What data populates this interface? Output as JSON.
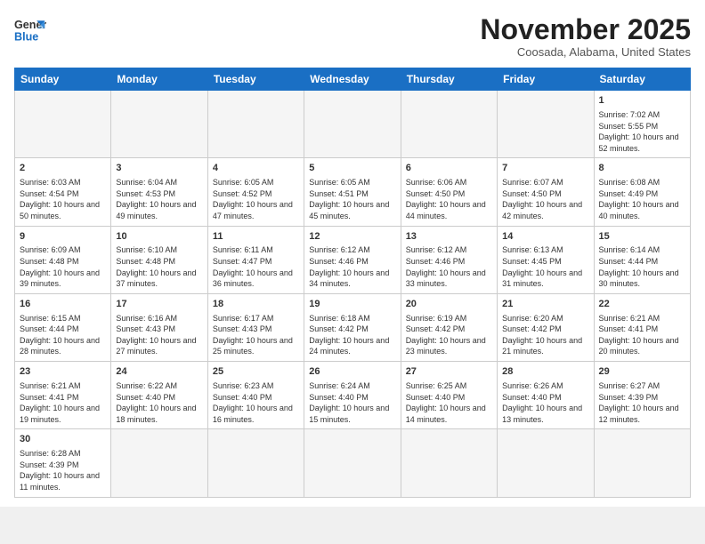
{
  "header": {
    "logo_general": "General",
    "logo_blue": "Blue",
    "month_title": "November 2025",
    "location": "Coosada, Alabama, United States"
  },
  "days_of_week": [
    "Sunday",
    "Monday",
    "Tuesday",
    "Wednesday",
    "Thursday",
    "Friday",
    "Saturday"
  ],
  "weeks": [
    [
      {
        "num": "",
        "info": "",
        "empty": true
      },
      {
        "num": "",
        "info": "",
        "empty": true
      },
      {
        "num": "",
        "info": "",
        "empty": true
      },
      {
        "num": "",
        "info": "",
        "empty": true
      },
      {
        "num": "",
        "info": "",
        "empty": true
      },
      {
        "num": "",
        "info": "",
        "empty": true
      },
      {
        "num": "1",
        "info": "Sunrise: 7:02 AM\nSunset: 5:55 PM\nDaylight: 10 hours\nand 52 minutes."
      }
    ],
    [
      {
        "num": "2",
        "info": "Sunrise: 6:03 AM\nSunset: 4:54 PM\nDaylight: 10 hours\nand 50 minutes."
      },
      {
        "num": "3",
        "info": "Sunrise: 6:04 AM\nSunset: 4:53 PM\nDaylight: 10 hours\nand 49 minutes."
      },
      {
        "num": "4",
        "info": "Sunrise: 6:05 AM\nSunset: 4:52 PM\nDaylight: 10 hours\nand 47 minutes."
      },
      {
        "num": "5",
        "info": "Sunrise: 6:05 AM\nSunset: 4:51 PM\nDaylight: 10 hours\nand 45 minutes."
      },
      {
        "num": "6",
        "info": "Sunrise: 6:06 AM\nSunset: 4:50 PM\nDaylight: 10 hours\nand 44 minutes."
      },
      {
        "num": "7",
        "info": "Sunrise: 6:07 AM\nSunset: 4:50 PM\nDaylight: 10 hours\nand 42 minutes."
      },
      {
        "num": "8",
        "info": "Sunrise: 6:08 AM\nSunset: 4:49 PM\nDaylight: 10 hours\nand 40 minutes."
      }
    ],
    [
      {
        "num": "9",
        "info": "Sunrise: 6:09 AM\nSunset: 4:48 PM\nDaylight: 10 hours\nand 39 minutes."
      },
      {
        "num": "10",
        "info": "Sunrise: 6:10 AM\nSunset: 4:48 PM\nDaylight: 10 hours\nand 37 minutes."
      },
      {
        "num": "11",
        "info": "Sunrise: 6:11 AM\nSunset: 4:47 PM\nDaylight: 10 hours\nand 36 minutes."
      },
      {
        "num": "12",
        "info": "Sunrise: 6:12 AM\nSunset: 4:46 PM\nDaylight: 10 hours\nand 34 minutes."
      },
      {
        "num": "13",
        "info": "Sunrise: 6:12 AM\nSunset: 4:46 PM\nDaylight: 10 hours\nand 33 minutes."
      },
      {
        "num": "14",
        "info": "Sunrise: 6:13 AM\nSunset: 4:45 PM\nDaylight: 10 hours\nand 31 minutes."
      },
      {
        "num": "15",
        "info": "Sunrise: 6:14 AM\nSunset: 4:44 PM\nDaylight: 10 hours\nand 30 minutes."
      }
    ],
    [
      {
        "num": "16",
        "info": "Sunrise: 6:15 AM\nSunset: 4:44 PM\nDaylight: 10 hours\nand 28 minutes."
      },
      {
        "num": "17",
        "info": "Sunrise: 6:16 AM\nSunset: 4:43 PM\nDaylight: 10 hours\nand 27 minutes."
      },
      {
        "num": "18",
        "info": "Sunrise: 6:17 AM\nSunset: 4:43 PM\nDaylight: 10 hours\nand 25 minutes."
      },
      {
        "num": "19",
        "info": "Sunrise: 6:18 AM\nSunset: 4:42 PM\nDaylight: 10 hours\nand 24 minutes."
      },
      {
        "num": "20",
        "info": "Sunrise: 6:19 AM\nSunset: 4:42 PM\nDaylight: 10 hours\nand 23 minutes."
      },
      {
        "num": "21",
        "info": "Sunrise: 6:20 AM\nSunset: 4:42 PM\nDaylight: 10 hours\nand 21 minutes."
      },
      {
        "num": "22",
        "info": "Sunrise: 6:21 AM\nSunset: 4:41 PM\nDaylight: 10 hours\nand 20 minutes."
      }
    ],
    [
      {
        "num": "23",
        "info": "Sunrise: 6:21 AM\nSunset: 4:41 PM\nDaylight: 10 hours\nand 19 minutes."
      },
      {
        "num": "24",
        "info": "Sunrise: 6:22 AM\nSunset: 4:40 PM\nDaylight: 10 hours\nand 18 minutes."
      },
      {
        "num": "25",
        "info": "Sunrise: 6:23 AM\nSunset: 4:40 PM\nDaylight: 10 hours\nand 16 minutes."
      },
      {
        "num": "26",
        "info": "Sunrise: 6:24 AM\nSunset: 4:40 PM\nDaylight: 10 hours\nand 15 minutes."
      },
      {
        "num": "27",
        "info": "Sunrise: 6:25 AM\nSunset: 4:40 PM\nDaylight: 10 hours\nand 14 minutes."
      },
      {
        "num": "28",
        "info": "Sunrise: 6:26 AM\nSunset: 4:40 PM\nDaylight: 10 hours\nand 13 minutes."
      },
      {
        "num": "29",
        "info": "Sunrise: 6:27 AM\nSunset: 4:39 PM\nDaylight: 10 hours\nand 12 minutes."
      }
    ],
    [
      {
        "num": "30",
        "info": "Sunrise: 6:28 AM\nSunset: 4:39 PM\nDaylight: 10 hours\nand 11 minutes.",
        "last": true
      },
      {
        "num": "",
        "info": "",
        "empty": true,
        "last": true
      },
      {
        "num": "",
        "info": "",
        "empty": true,
        "last": true
      },
      {
        "num": "",
        "info": "",
        "empty": true,
        "last": true
      },
      {
        "num": "",
        "info": "",
        "empty": true,
        "last": true
      },
      {
        "num": "",
        "info": "",
        "empty": true,
        "last": true
      },
      {
        "num": "",
        "info": "",
        "empty": true,
        "last": true
      }
    ]
  ]
}
